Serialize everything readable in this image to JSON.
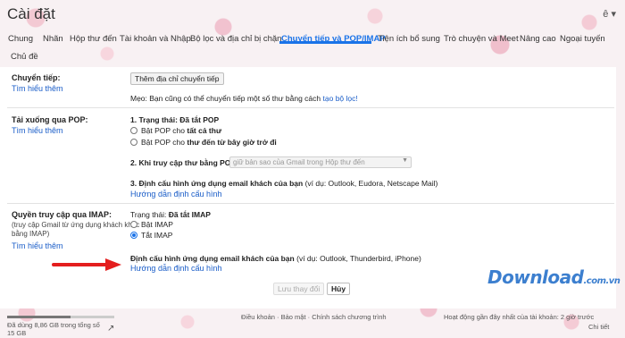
{
  "header": {
    "title": "Cài đặt",
    "input_tools_label": "ê"
  },
  "tabs": [
    {
      "label": "Chung"
    },
    {
      "label": "Nhãn"
    },
    {
      "label": "Hộp thư đến"
    },
    {
      "label": "Tài khoản và Nhập"
    },
    {
      "label": "Bộ lọc và địa chỉ bị chặn"
    },
    {
      "label": "Chuyển tiếp và POP/IMAP",
      "active": true
    },
    {
      "label": "Tiện ích bổ sung"
    },
    {
      "label": "Trò chuyện và Meet"
    },
    {
      "label": "Nâng cao"
    },
    {
      "label": "Ngoại tuyến"
    },
    {
      "label": "Chủ đề"
    }
  ],
  "forwarding": {
    "label": "Chuyển tiếp:",
    "learn_more": "Tìm hiểu thêm",
    "add_address_button": "Thêm địa chỉ chuyển tiếp",
    "tip_text": "Mẹo: Bạn cũng có thể chuyển tiếp một số thư bằng cách",
    "tip_link": "tạo bộ lọc!"
  },
  "pop": {
    "label": "Tải xuống qua POP:",
    "learn_more": "Tìm hiểu thêm",
    "status_prefix": "1. Trạng thái:",
    "status_value": "Đã tắt POP",
    "option_all_prefix": "Bật POP cho",
    "option_all_bold": "tất cả thư",
    "option_from_now_prefix": "Bật POP cho",
    "option_from_now_bold": "thư đến từ bây giờ trở đi",
    "when_accessed_label": "2. Khi truy cập thư bằng POP",
    "when_accessed_select": "giữ bản sao của Gmail trong Hộp thư đến",
    "configure_label": "3. Định cấu hình ứng dụng email khách của bạn",
    "configure_hint": "(ví dụ: Outlook, Eudora, Netscape Mail)",
    "configure_link": "Hướng dẫn định cấu hình"
  },
  "imap": {
    "label": "Quyền truy cập qua IMAP:",
    "sub_line1": "(truy cập Gmail từ ứng dụng khách khác",
    "sub_line2": "bằng IMAP)",
    "learn_more": "Tìm hiểu thêm",
    "status_prefix": "Trạng thái:",
    "status_value": "Đã tắt IMAP",
    "option_enable": "Bật IMAP",
    "option_disable": "Tắt IMAP",
    "selected": "disable",
    "configure_label": "Định cấu hình ứng dụng email khách của bạn",
    "configure_hint": "(ví dụ: Outlook, Thunderbird, iPhone)",
    "configure_link": "Hướng dẫn định cấu hình"
  },
  "actions": {
    "save_label": "Lưu thay đổi",
    "cancel_label": "Hủy"
  },
  "footer": {
    "storage_line1": "Đã dùng 8,86 GB trong tổng số",
    "storage_line2": "15 GB",
    "storage_fraction": 0.59,
    "terms": "Điều khoản",
    "privacy": "Bảo mật",
    "program_policies": "Chính sách chương trình",
    "activity_line": "Hoạt động gần đây nhất của tài khoản: 2 giờ trước",
    "details": "Chi tiết"
  },
  "watermark": {
    "brand": "Download",
    "domain": ".com.vn"
  },
  "colors": {
    "accent": "#1a73e8",
    "link": "#1a5dc8",
    "arrow": "#e41e1e"
  }
}
